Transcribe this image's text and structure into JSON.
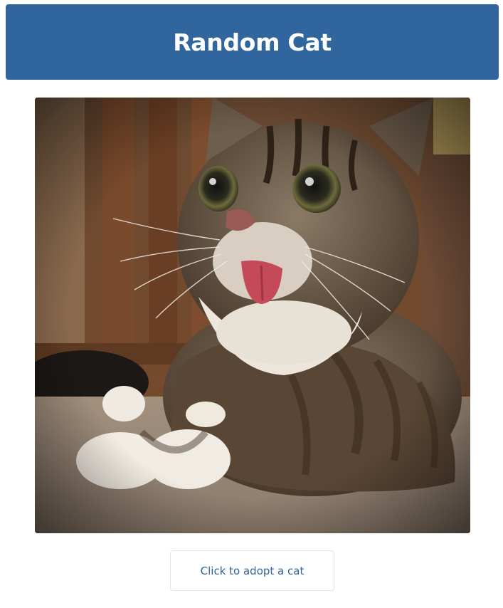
{
  "header": {
    "title": "Random Cat"
  },
  "cat_image": {
    "alt": "cat photo"
  },
  "adopt_button": {
    "label": "Click to adopt a cat"
  },
  "colors": {
    "header_background": "#31659d",
    "header_text": "#ffffff",
    "button_text": "#31659d",
    "button_border": "#e2e4e8"
  }
}
